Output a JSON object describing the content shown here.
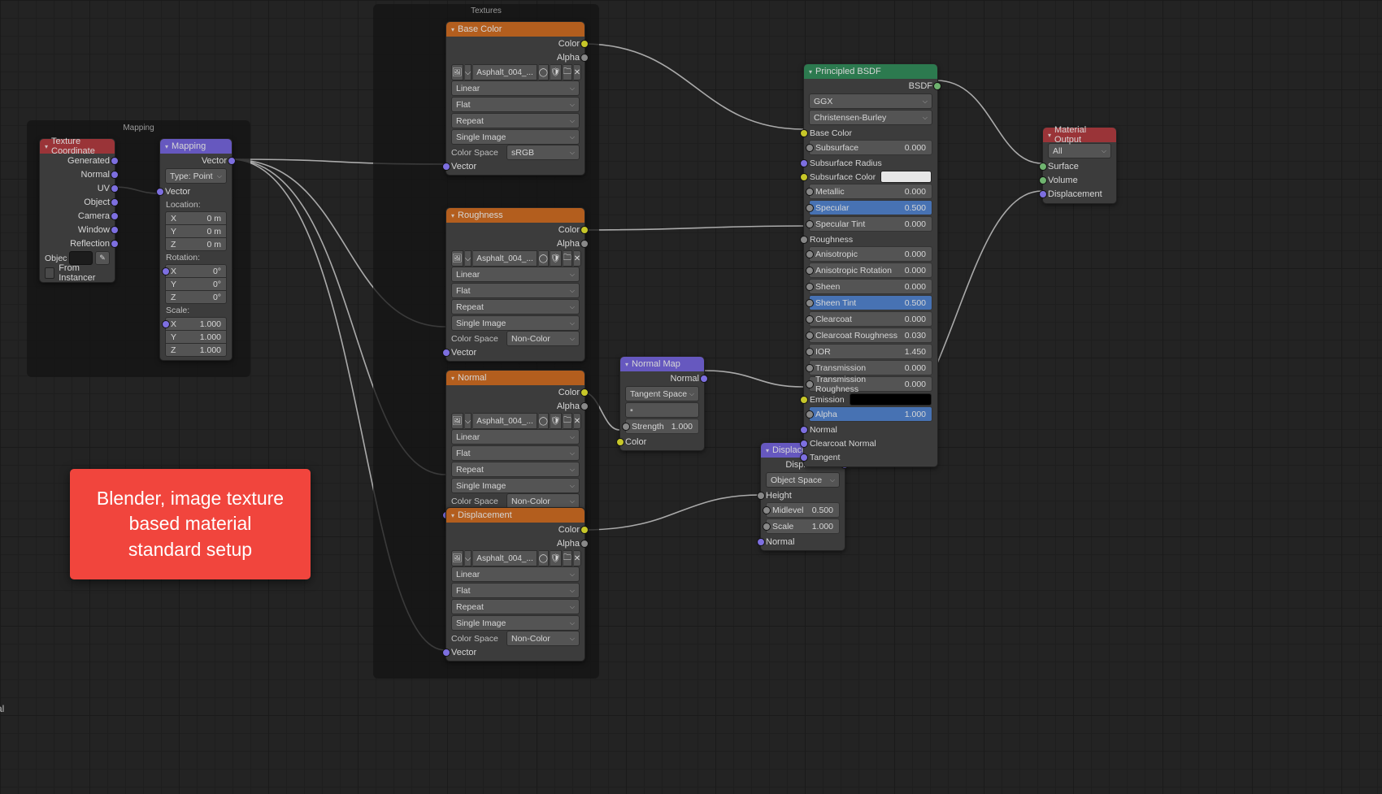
{
  "panels": {
    "mapping_label": "Mapping",
    "textures_label": "Textures"
  },
  "annotation": "Blender, image texture\nbased material\nstandard setup",
  "truncated_text": "al",
  "tex_coord": {
    "title": "Texture Coordinate",
    "outputs": [
      "Generated",
      "Normal",
      "UV",
      "Object",
      "Camera",
      "Window",
      "Reflection"
    ],
    "object_label": "Objec",
    "from_instancer": "From Instancer"
  },
  "mapping": {
    "title": "Mapping",
    "out": "Vector",
    "type_label": "Type:",
    "type_value": "Point",
    "in_vector": "Vector",
    "loc_label": "Location:",
    "loc": {
      "X": "0 m",
      "Y": "0 m",
      "Z": "0 m"
    },
    "rot_label": "Rotation:",
    "rot": {
      "X": "0°",
      "Y": "0°",
      "Z": "0°"
    },
    "scale_label": "Scale:",
    "scale": {
      "X": "1.000",
      "Y": "1.000",
      "Z": "1.000"
    }
  },
  "img_tex": {
    "image_name": "Asphalt_004_...",
    "interp": "Linear",
    "proj": "Flat",
    "ext": "Repeat",
    "src": "Single Image",
    "cs_label": "Color Space",
    "cs_srgb": "sRGB",
    "cs_noncolor": "Non-Color",
    "out_color": "Color",
    "out_alpha": "Alpha",
    "in_vector": "Vector"
  },
  "tex_nodes": {
    "base": "Base Color",
    "rough": "Roughness",
    "normal": "Normal",
    "disp": "Displacement"
  },
  "normal_map": {
    "title": "Normal Map",
    "out": "Normal",
    "space": "Tangent Space",
    "uv_placeholder": "",
    "strength_label": "Strength",
    "strength_val": "1.000",
    "in_color": "Color"
  },
  "displacement": {
    "title": "Displacement",
    "out": "Displacement",
    "space": "Object Space",
    "height": "Height",
    "mid_label": "Midlevel",
    "mid_val": "0.500",
    "scale_label": "Scale",
    "scale_val": "1.000",
    "normal": "Normal"
  },
  "bsdf": {
    "title": "Principled BSDF",
    "out": "BSDF",
    "dist": "GGX",
    "sss_method": "Christensen-Burley",
    "base_color": "Base Color",
    "subsurface": {
      "l": "Subsurface",
      "v": "0.000"
    },
    "sss_radius": "Subsurface Radius",
    "sss_color": "Subsurface Color",
    "metallic": {
      "l": "Metallic",
      "v": "0.000"
    },
    "specular": {
      "l": "Specular",
      "v": "0.500"
    },
    "spec_tint": {
      "l": "Specular Tint",
      "v": "0.000"
    },
    "roughness": "Roughness",
    "aniso": {
      "l": "Anisotropic",
      "v": "0.000"
    },
    "aniso_rot": {
      "l": "Anisotropic Rotation",
      "v": "0.000"
    },
    "sheen": {
      "l": "Sheen",
      "v": "0.000"
    },
    "sheen_tint": {
      "l": "Sheen Tint",
      "v": "0.500"
    },
    "clearcoat": {
      "l": "Clearcoat",
      "v": "0.000"
    },
    "cc_rough": {
      "l": "Clearcoat Roughness",
      "v": "0.030"
    },
    "ior": {
      "l": "IOR",
      "v": "1.450"
    },
    "trans": {
      "l": "Transmission",
      "v": "0.000"
    },
    "trans_rough": {
      "l": "Transmission Roughness",
      "v": "0.000"
    },
    "emission": "Emission",
    "alpha": {
      "l": "Alpha",
      "v": "1.000"
    },
    "normal": "Normal",
    "cc_normal": "Clearcoat Normal",
    "tangent": "Tangent"
  },
  "mat_out": {
    "title": "Material Output",
    "target": "All",
    "surface": "Surface",
    "volume": "Volume",
    "disp": "Displacement"
  }
}
